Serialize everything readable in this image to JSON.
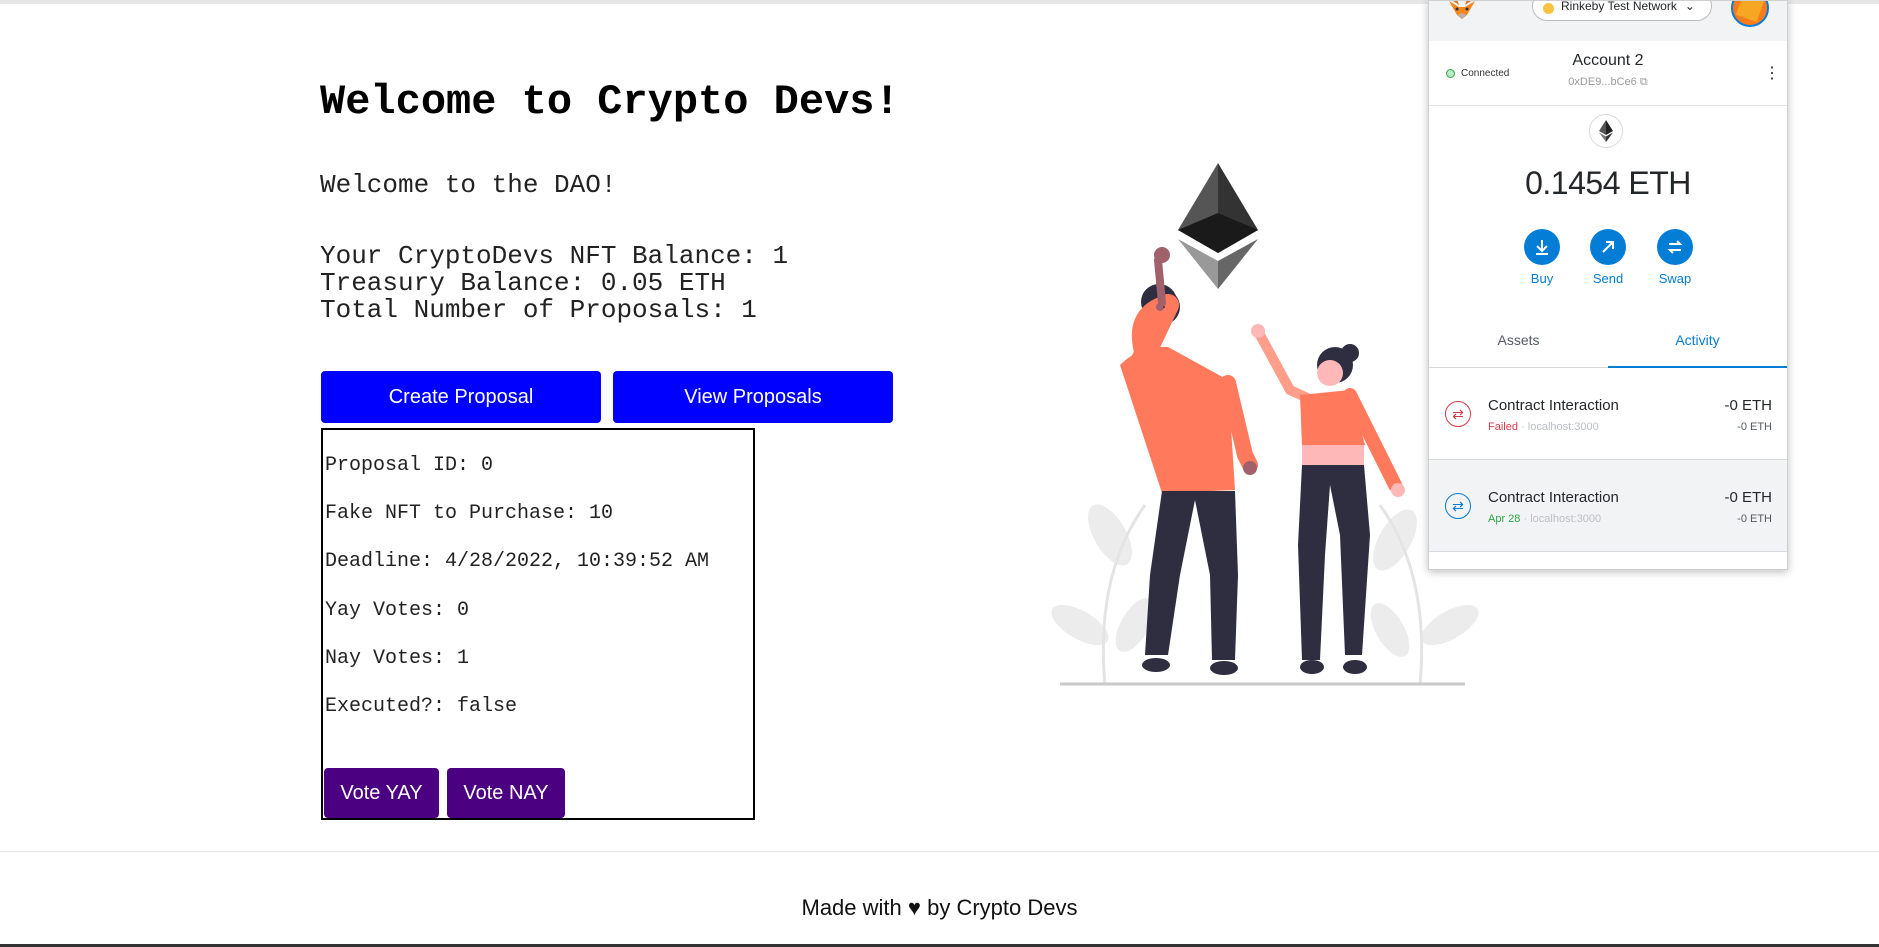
{
  "page": {
    "title": "Welcome to Crypto Devs!",
    "subtitle": "Welcome to the DAO!",
    "nft_balance": "Your CryptoDevs NFT Balance: 1",
    "treasury_balance": "Treasury Balance: 0.05 ETH",
    "total_proposals": "Total Number of Proposals: 1",
    "create_proposal_label": "Create Proposal",
    "view_proposals_label": "View Proposals"
  },
  "proposal": {
    "id": "Proposal ID: 0",
    "nft_to_purchase": "Fake NFT to Purchase: 10",
    "deadline": "Deadline: 4/28/2022, 10:39:52 AM",
    "yay_votes": "Yay Votes: 0",
    "nay_votes": "Nay Votes: 1",
    "executed": "Executed?: false",
    "vote_yay_label": "Vote YAY",
    "vote_nay_label": "Vote NAY"
  },
  "footer": {
    "made_with": "Made with",
    "by": "by Crypto Devs"
  },
  "metamask": {
    "network": "Rinkeby Test Network",
    "connected": "Connected",
    "account_name": "Account 2",
    "address": "0xDE9...bCe6",
    "balance": "0.1454 ETH",
    "actions": [
      {
        "label": "Buy",
        "icon": "download-icon"
      },
      {
        "label": "Send",
        "icon": "arrow-up-right-icon"
      },
      {
        "label": "Swap",
        "icon": "swap-icon"
      }
    ],
    "tabs": [
      "Assets",
      "Activity"
    ],
    "transactions": [
      {
        "title": "Contract Interaction",
        "status": "Failed",
        "origin": "localhost:3000",
        "amount": "-0 ETH",
        "amount_secondary": "-0 ETH"
      },
      {
        "title": "Contract Interaction",
        "status": "Apr 28",
        "origin": "localhost:3000",
        "amount": "-0 ETH",
        "amount_secondary": "-0 ETH"
      }
    ]
  },
  "colors": {
    "primary_button": "#0000ff",
    "vote_button": "#4b0082",
    "metamask_blue": "#037dd6",
    "failed": "#d73a49",
    "success": "#28a745",
    "illustration_coral": "#ff7a5c",
    "illustration_dark": "#2f2e41"
  }
}
